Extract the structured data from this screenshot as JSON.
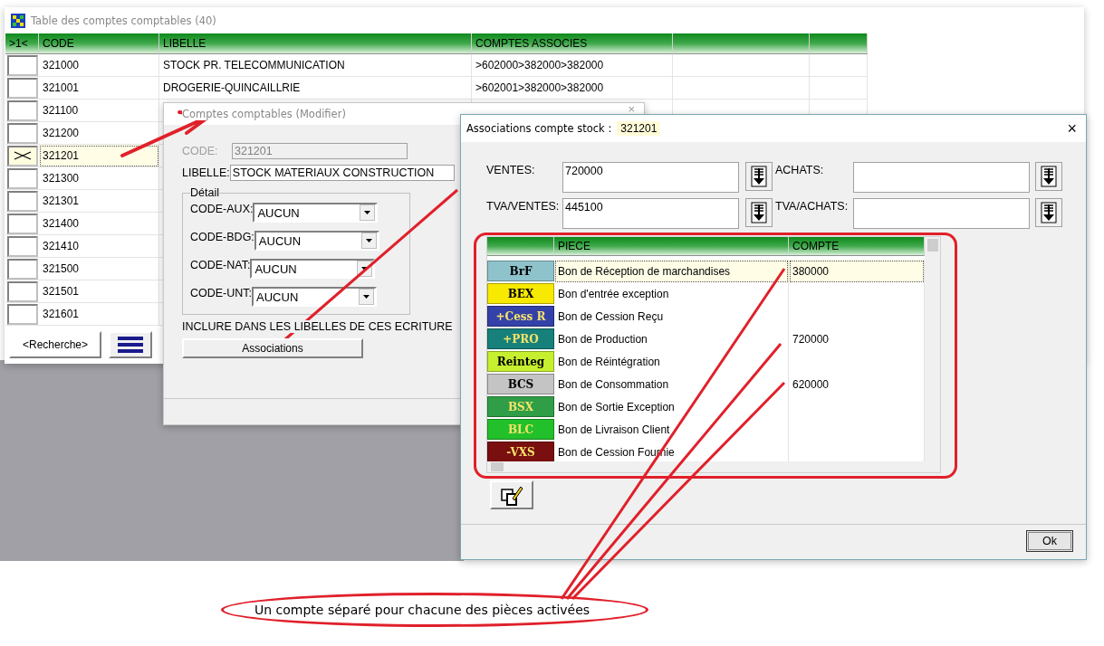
{
  "main_window": {
    "title": "Table des comptes comptables (40)",
    "columns": [
      ">1<",
      "CODE",
      "LIBELLE",
      "COMPTES ASSOCIES"
    ],
    "rows": [
      {
        "code": "321000",
        "libelle": "STOCK PR. TELECOMMUNICATION",
        "comptes": ">602000>382000>382000",
        "selected": false
      },
      {
        "code": "321001",
        "libelle": "DROGERIE-QUINCAILLRIE",
        "comptes": ">602001>382000>382000",
        "selected": false
      },
      {
        "code": "321100",
        "selected": false
      },
      {
        "code": "321200",
        "selected": false
      },
      {
        "code": "321201",
        "selected": true
      },
      {
        "code": "321300",
        "selected": false
      },
      {
        "code": "321301",
        "selected": false
      },
      {
        "code": "321400",
        "selected": false
      },
      {
        "code": "321410",
        "selected": false
      },
      {
        "code": "321500",
        "selected": false
      },
      {
        "code": "321501",
        "selected": false
      },
      {
        "code": "321601",
        "selected": false
      }
    ],
    "search_button": "<Recherche>"
  },
  "edit_dialog": {
    "title": "Comptes comptables  (Modifier)",
    "close": "×",
    "code_label": "CODE:",
    "code_value": "321201",
    "libelle_label": "LIBELLE:",
    "libelle_value": "STOCK MATERIAUX CONSTRUCTION",
    "group_title": "Détail",
    "combos": [
      {
        "label": "CODE-AUX:",
        "value": "AUCUN"
      },
      {
        "label": "CODE-BDG:",
        "value": "AUCUN"
      },
      {
        "label": "CODE-NAT:",
        "value": "AUCUN"
      },
      {
        "label": "CODE-UNT:",
        "value": "AUCUN"
      }
    ],
    "include_text": "INCLURE DANS LES LIBELLES DE CES ECRITURE",
    "associations_button": "Associations"
  },
  "assoc_dialog": {
    "title": "Associations compte stock :",
    "stock_code": "321201",
    "close": "×",
    "fields": [
      {
        "label": "VENTES:",
        "value": "720000"
      },
      {
        "label": "ACHATS:"
      },
      {
        "label": "TVA/VENTES:",
        "value": "445100"
      },
      {
        "label": "TVA/ACHATS:"
      }
    ],
    "grid": {
      "columns": [
        "PIECE",
        "COMPTE"
      ],
      "rows": [
        {
          "badge": "BrF",
          "color": "#8ec3cc",
          "piece": "Bon de Réception de marchandises",
          "compte": "380000",
          "selected": true
        },
        {
          "badge": "BEX",
          "color": "#f7e900",
          "piece": "Bon d'entrée exception",
          "selected": false
        },
        {
          "badge": "+Cess R",
          "color": "#3341a8",
          "piece": "Bon de Cession Reçu",
          "selected": false
        },
        {
          "badge": "+PRO",
          "color": "#17807a",
          "piece": "Bon de Production",
          "compte": "720000",
          "selected": false
        },
        {
          "badge": "Reinteg",
          "color": "#c6ef2f",
          "piece": "Bon de Réintégration",
          "selected": false
        },
        {
          "badge": "BCS",
          "color": "#c4c4c4",
          "piece": "Bon de Consommation",
          "compte": "620000",
          "selected": false
        },
        {
          "badge": "BSX",
          "color": "#2f9e46",
          "piece": "Bon de Sortie Exception",
          "selected": false
        },
        {
          "badge": "BLC",
          "color": "#22c02a",
          "piece": "Bon de Livraison Client",
          "selected": false
        },
        {
          "badge": "-VXS",
          "color": "#7a0f0f",
          "piece": "Bon de Cession Fournie",
          "selected": false
        }
      ]
    },
    "ok_button": "Ok"
  },
  "annotation": {
    "text": "Un compte séparé pour chacune des pièces activées"
  }
}
